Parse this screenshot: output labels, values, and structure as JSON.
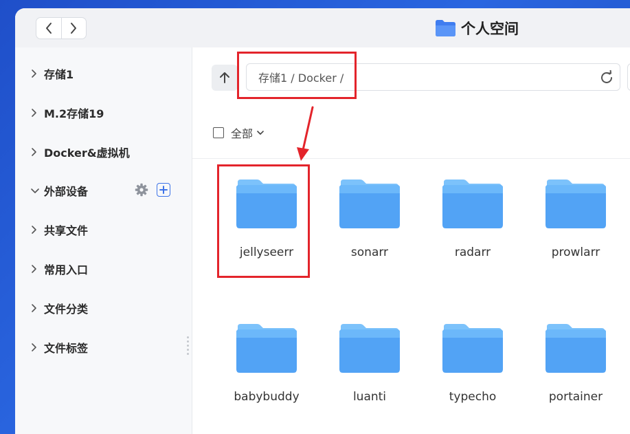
{
  "window": {
    "title": "个人空间",
    "title_icon": "folder-icon"
  },
  "titlebar": {
    "back_icon": "chevron-left-icon",
    "forward_icon": "chevron-right-icon"
  },
  "sidebar": {
    "items": [
      {
        "label": "存储1",
        "expanded": false
      },
      {
        "label": "M.2存储19",
        "expanded": false
      },
      {
        "label": "Docker&虚拟机",
        "expanded": false
      },
      {
        "label": "外部设备",
        "expanded": true
      },
      {
        "label": "共享文件",
        "expanded": false
      },
      {
        "label": "常用入口",
        "expanded": false
      },
      {
        "label": "文件分类",
        "expanded": false
      },
      {
        "label": "文件标签",
        "expanded": false
      }
    ],
    "external_tools": [
      "gear-icon",
      "plus-icon"
    ]
  },
  "toolbar": {
    "up_icon": "arrow-up-icon",
    "path": "存储1 / Docker /",
    "refresh_icon": "refresh-icon"
  },
  "selection": {
    "label": "全部"
  },
  "folders": [
    {
      "name": "jellyseerr"
    },
    {
      "name": "sonarr"
    },
    {
      "name": "radarr"
    },
    {
      "name": "prowlarr"
    },
    {
      "name": "babybuddy"
    },
    {
      "name": "luanti"
    },
    {
      "name": "typecho"
    },
    {
      "name": "portainer"
    }
  ],
  "colors": {
    "accent": "#3d73e8",
    "folder_back": "#7cc2fb",
    "folder_front": "#52a3f5",
    "annotation": "#e3242b"
  }
}
